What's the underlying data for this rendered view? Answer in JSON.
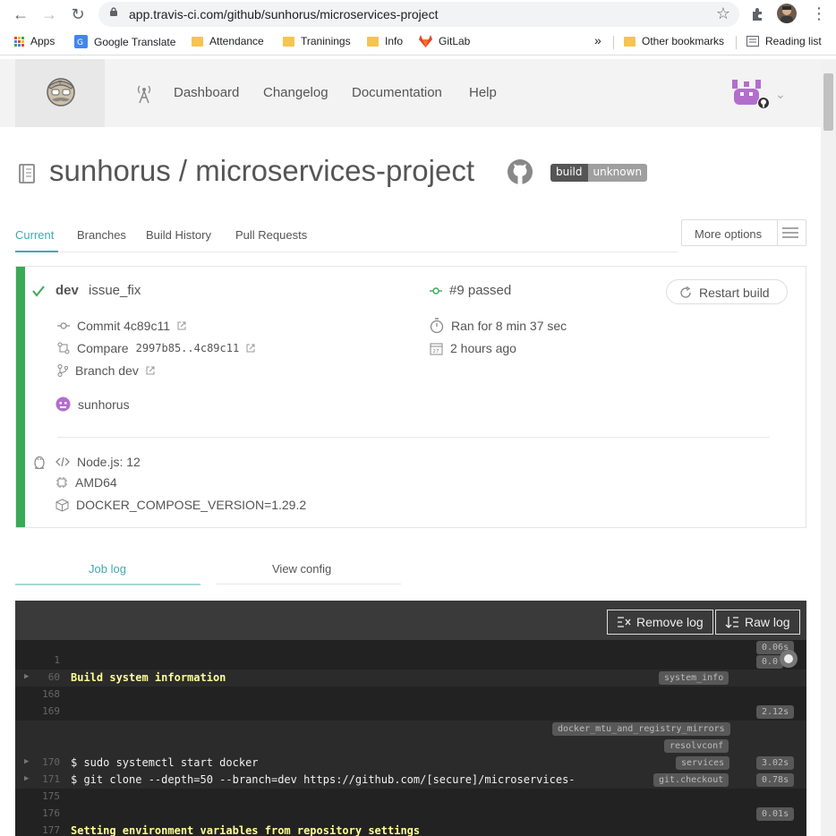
{
  "browser": {
    "url": "app.travis-ci.com/github/sunhorus/microservices-project",
    "bookmarks": [
      "Apps",
      "Google Translate",
      "Attendance",
      "Traninings",
      "Info",
      "GitLab"
    ],
    "overflow": "»",
    "other_bookmarks": "Other bookmarks",
    "reading_list": "Reading list"
  },
  "nav": {
    "items": [
      "Dashboard",
      "Changelog",
      "Documentation",
      "Help"
    ]
  },
  "repo": {
    "title": "sunhorus / microservices-project",
    "badge_left": "build",
    "badge_right": "unknown"
  },
  "tabs": [
    "Current",
    "Branches",
    "Build History",
    "Pull Requests"
  ],
  "more_options": "More options",
  "build": {
    "branch": "dev",
    "message": "issue_fix",
    "status": "#9 passed",
    "restart_label": "Restart build",
    "commit": "Commit 4c89c11",
    "compare_label": "Compare",
    "compare_range": "2997b85..4c89c11",
    "branch_link": "Branch dev",
    "duration": "Ran for 8 min 37 sec",
    "finished": "2 hours ago",
    "author": "sunhorus",
    "language": "Node.js: 12",
    "arch": "AMD64",
    "env": "DOCKER_COMPOSE_VERSION=1.29.2"
  },
  "log_tabs": [
    "Job log",
    "View config"
  ],
  "log": {
    "remove_log": "Remove log",
    "raw_log": "Raw log",
    "lines": [
      {
        "n": "1",
        "text": "",
        "tags": [],
        "durs": [
          "0.06s",
          "0.0"
        ]
      },
      {
        "n": "60",
        "text": "Build system information",
        "tags": [
          "system_info"
        ],
        "durs": []
      },
      {
        "n": "168",
        "text": "",
        "tags": [],
        "durs": []
      },
      {
        "n": "169",
        "text": "",
        "tags": [],
        "durs": [
          "2.12s"
        ]
      },
      {
        "n": "",
        "text": "",
        "tags": [
          "docker_mtu_and_registry_mirrors"
        ],
        "durs": []
      },
      {
        "n": "",
        "text": "",
        "tags": [
          "resolvconf"
        ],
        "durs": []
      },
      {
        "n": "170",
        "text": "$ sudo systemctl start docker",
        "tags": [
          "services"
        ],
        "durs": [
          "3.02s"
        ]
      },
      {
        "n": "171",
        "text": "$ git clone --depth=50 --branch=dev https://github.com/[secure]/microservices-",
        "tags": [
          "git.checkout"
        ],
        "durs": [
          "0.78s"
        ]
      },
      {
        "n": "175",
        "text": "",
        "tags": [],
        "durs": []
      },
      {
        "n": "176",
        "text": "",
        "tags": [],
        "durs": [
          "0.01s"
        ]
      },
      {
        "n": "177",
        "text": "Setting environment variables from repository settings",
        "tags": [],
        "durs": []
      }
    ]
  },
  "colors": {
    "accent": "#3eaaaf",
    "passed": "#39aa56",
    "log_bg": "#222222",
    "log_yellow": "#ffff91"
  }
}
